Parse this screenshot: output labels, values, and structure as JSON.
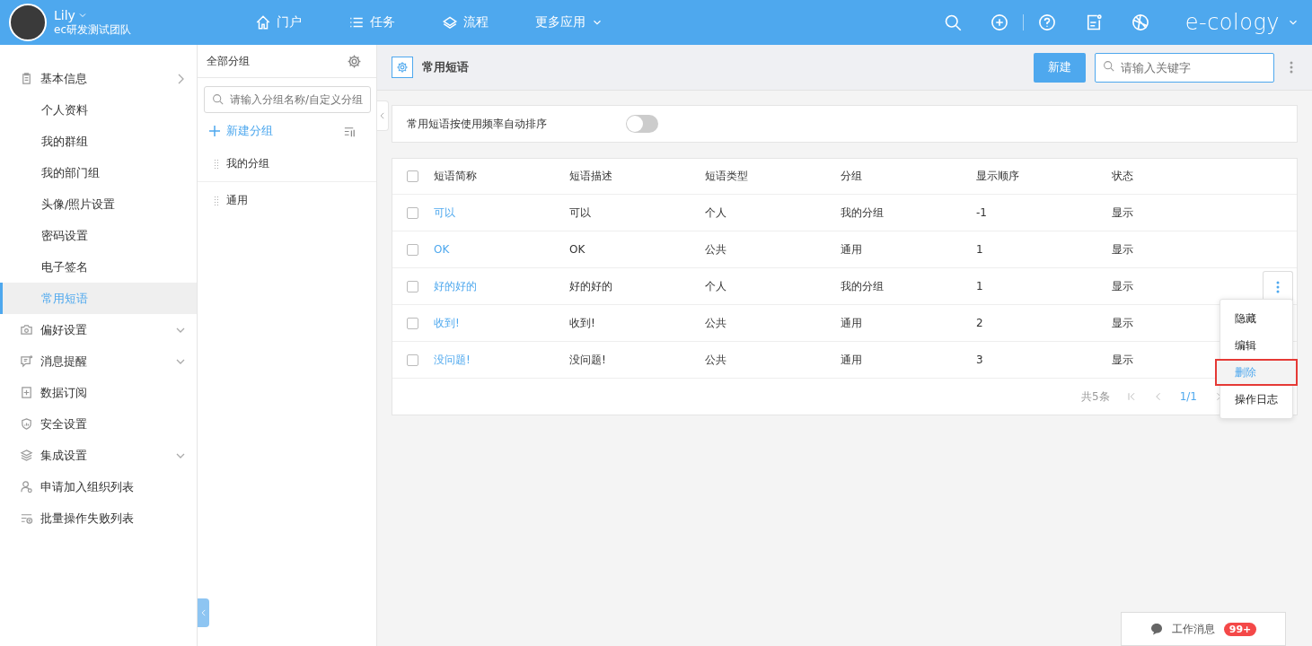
{
  "header": {
    "user": {
      "name": "Lily",
      "team": "ec研发测试团队"
    },
    "nav": [
      {
        "label": "门户",
        "kind": "link"
      },
      {
        "label": "任务",
        "kind": "link"
      },
      {
        "label": "流程",
        "kind": "link"
      },
      {
        "label": "更多应用",
        "kind": "dropdown"
      }
    ],
    "brand": "e-cology"
  },
  "sidebar": {
    "items": [
      {
        "label": "基本信息",
        "kind": "group",
        "expanded": true,
        "children": [
          {
            "label": "个人资料",
            "selected": false
          },
          {
            "label": "我的群组",
            "selected": false
          },
          {
            "label": "我的部门组",
            "selected": false
          },
          {
            "label": "头像/照片设置",
            "selected": false
          },
          {
            "label": "密码设置",
            "selected": false
          },
          {
            "label": "电子签名",
            "selected": false
          },
          {
            "label": "常用短语",
            "selected": true
          }
        ]
      },
      {
        "label": "偏好设置",
        "kind": "group",
        "expanded": false
      },
      {
        "label": "消息提醒",
        "kind": "group",
        "expanded": false
      },
      {
        "label": "数据订阅",
        "kind": "leaf"
      },
      {
        "label": "安全设置",
        "kind": "leaf"
      },
      {
        "label": "集成设置",
        "kind": "group",
        "expanded": false
      },
      {
        "label": "申请加入组织列表",
        "kind": "leaf"
      },
      {
        "label": "批量操作失败列表",
        "kind": "leaf"
      }
    ]
  },
  "groups": {
    "title": "全部分组",
    "search": {
      "placeholder": "请输入分组名称/自定义分组"
    },
    "add": "新建分组",
    "items": [
      {
        "label": "我的分组"
      },
      {
        "label": "通用"
      }
    ]
  },
  "main": {
    "title": "常用短语",
    "new_button": "新建",
    "search": {
      "placeholder": "请输入关键字"
    },
    "toggle": {
      "label": "常用短语按使用频率自动排序",
      "on": false
    },
    "table": {
      "all_checked": false,
      "columns": [
        "短语简称",
        "短语描述",
        "短语类型",
        "分组",
        "显示顺序",
        "状态"
      ],
      "rows": [
        {
          "checked": false,
          "menu_open": false,
          "cells": [
            "可以",
            "可以",
            "个人",
            "我的分组",
            "-1",
            "显示"
          ]
        },
        {
          "checked": false,
          "menu_open": false,
          "cells": [
            "OK",
            "OK",
            "公共",
            "通用",
            "1",
            "显示"
          ]
        },
        {
          "checked": false,
          "menu_open": true,
          "cells": [
            "好的好的",
            "好的好的",
            "个人",
            "我的分组",
            "1",
            "显示"
          ]
        },
        {
          "checked": false,
          "menu_open": false,
          "cells": [
            "收到!",
            "收到!",
            "公共",
            "通用",
            "2",
            "显示"
          ]
        },
        {
          "checked": false,
          "menu_open": false,
          "cells": [
            "没问题!",
            "没问题!",
            "公共",
            "通用",
            "3",
            "显示"
          ]
        }
      ]
    },
    "pagination": {
      "total": "共5条",
      "page": "1/1"
    },
    "menu": [
      {
        "label": "隐藏",
        "selected": false
      },
      {
        "label": "编辑",
        "selected": false
      },
      {
        "label": "删除",
        "selected": true
      },
      {
        "label": "操作日志",
        "selected": false
      }
    ]
  },
  "chat": {
    "label": "工作消息",
    "badge": "99+"
  }
}
